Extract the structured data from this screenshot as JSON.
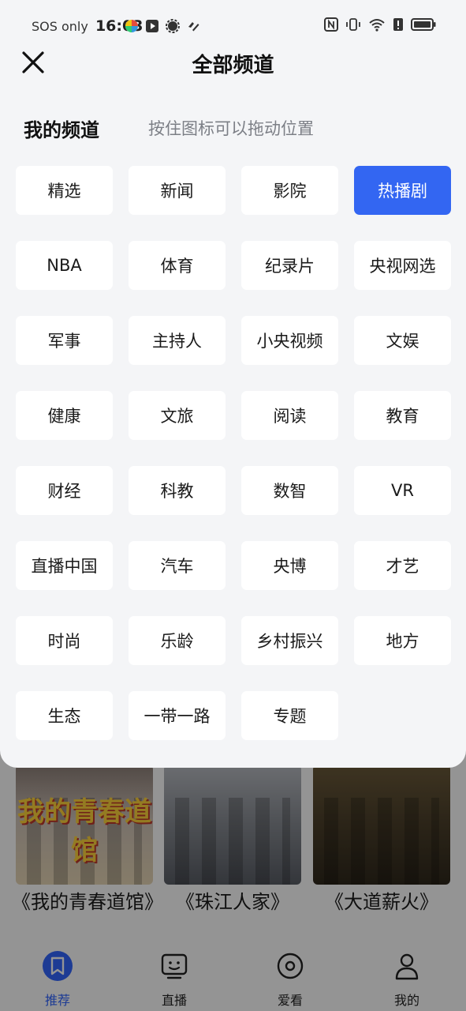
{
  "status_bar": {
    "carrier": "SOS only",
    "time": "16:03"
  },
  "sheet": {
    "title": "全部频道",
    "section_title": "我的频道",
    "section_hint": "按住图标可以拖动位置",
    "channels": [
      {
        "label": "精选",
        "active": false
      },
      {
        "label": "新闻",
        "active": false
      },
      {
        "label": "影院",
        "active": false
      },
      {
        "label": "热播剧",
        "active": true
      },
      {
        "label": "NBA",
        "active": false
      },
      {
        "label": "体育",
        "active": false
      },
      {
        "label": "纪录片",
        "active": false
      },
      {
        "label": "央视网选",
        "active": false
      },
      {
        "label": "军事",
        "active": false
      },
      {
        "label": "主持人",
        "active": false
      },
      {
        "label": "小央视频",
        "active": false
      },
      {
        "label": "文娱",
        "active": false
      },
      {
        "label": "健康",
        "active": false
      },
      {
        "label": "文旅",
        "active": false
      },
      {
        "label": "阅读",
        "active": false
      },
      {
        "label": "教育",
        "active": false
      },
      {
        "label": "财经",
        "active": false
      },
      {
        "label": "科教",
        "active": false
      },
      {
        "label": "数智",
        "active": false
      },
      {
        "label": "VR",
        "active": false
      },
      {
        "label": "直播中国",
        "active": false
      },
      {
        "label": "汽车",
        "active": false
      },
      {
        "label": "央博",
        "active": false
      },
      {
        "label": "才艺",
        "active": false
      },
      {
        "label": "时尚",
        "active": false
      },
      {
        "label": "乐龄",
        "active": false
      },
      {
        "label": "乡村振兴",
        "active": false
      },
      {
        "label": "地方",
        "active": false
      },
      {
        "label": "生态",
        "active": false
      },
      {
        "label": "一带一路",
        "active": false
      },
      {
        "label": "专题",
        "active": false
      }
    ]
  },
  "background": {
    "posters": [
      {
        "title": "《我的青春道馆》",
        "logo_text": "我的青春道馆"
      },
      {
        "title": "《珠江人家》"
      },
      {
        "title": "《大道薪火》"
      }
    ],
    "tabs": [
      {
        "label": "推荐",
        "icon": "bookmark-icon",
        "active": true
      },
      {
        "label": "直播",
        "icon": "tv-icon",
        "active": false
      },
      {
        "label": "爱看",
        "icon": "record-icon",
        "active": false
      },
      {
        "label": "我的",
        "icon": "user-icon",
        "active": false
      }
    ]
  },
  "colors": {
    "accent": "#3366f2",
    "sheet_bg": "#f4f5f7",
    "chip_bg": "#ffffff",
    "hint_text": "#7c7f86"
  }
}
